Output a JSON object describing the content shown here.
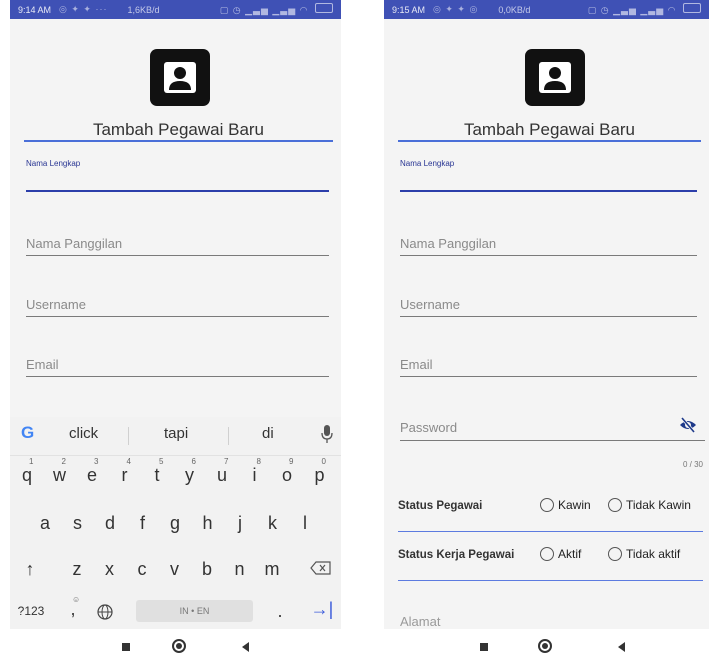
{
  "left": {
    "status_bar": {
      "time": "9:14 AM",
      "speed": "1,6KB/d"
    },
    "form_title": "Tambah Pegawai Baru",
    "fields": {
      "nama_lengkap_label": "Nama Lengkap",
      "nama_panggilan_placeholder": "Nama Panggilan",
      "username_placeholder": "Username",
      "email_placeholder": "Email"
    },
    "keyboard": {
      "suggestions": [
        "click",
        "tapi",
        "di"
      ],
      "row1": [
        "q",
        "w",
        "e",
        "r",
        "t",
        "y",
        "u",
        "i",
        "o",
        "p"
      ],
      "row1_numbers": [
        "1",
        "2",
        "3",
        "4",
        "5",
        "6",
        "7",
        "8",
        "9",
        "0"
      ],
      "row2": [
        "a",
        "s",
        "d",
        "f",
        "g",
        "h",
        "j",
        "k",
        "l"
      ],
      "row3": [
        "z",
        "x",
        "c",
        "v",
        "b",
        "n",
        "m"
      ],
      "symbols_key": "?123",
      "comma_key": ",",
      "period_key": ".",
      "space_label": "IN • EN"
    }
  },
  "right": {
    "status_bar": {
      "time": "9:15 AM",
      "speed": "0,0KB/d"
    },
    "form_title": "Tambah Pegawai Baru",
    "fields": {
      "nama_lengkap_label": "Nama Lengkap",
      "nama_panggilan_placeholder": "Nama Panggilan",
      "username_placeholder": "Username",
      "email_placeholder": "Email",
      "password_placeholder": "Password",
      "password_counter": "0 / 30",
      "alamat_placeholder": "Alamat"
    },
    "status_pegawai": {
      "label": "Status Pegawai",
      "options": [
        "Kawin",
        "Tidak Kawin"
      ]
    },
    "status_kerja": {
      "label": "Status Kerja Pegawai",
      "options": [
        "Aktif",
        "Tidak aktif"
      ]
    }
  },
  "colors": {
    "status_bar": "#3f51b5",
    "accent": "#4a6fd8",
    "focus_line": "#2c3eaa",
    "eye_icon": "#1e3a8a"
  }
}
